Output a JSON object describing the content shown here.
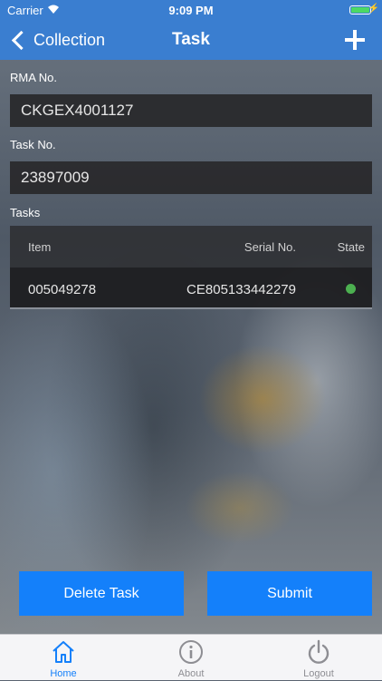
{
  "status_bar": {
    "carrier": "Carrier",
    "time": "9:09 PM"
  },
  "nav": {
    "back_label": "Collection",
    "title": "Task",
    "add_icon": "plus-icon"
  },
  "form": {
    "rma_label": "RMA No.",
    "rma_value": "CKGEX4001127",
    "task_label": "Task No.",
    "task_value": "23897009",
    "tasks_label": "Tasks"
  },
  "table": {
    "headers": {
      "item": "Item",
      "serial": "Serial No.",
      "state": "State"
    },
    "rows": [
      {
        "item": "005049278",
        "serial": "CE805133442279",
        "state_color": "#4cb050"
      }
    ]
  },
  "buttons": {
    "delete": "Delete Task",
    "submit": "Submit"
  },
  "tabs": [
    {
      "label": "Home",
      "icon": "home-icon",
      "active": true
    },
    {
      "label": "About",
      "icon": "info-icon",
      "active": false
    },
    {
      "label": "Logout",
      "icon": "power-icon",
      "active": false
    }
  ],
  "colors": {
    "accent": "#1480fa",
    "navbar": "#3a7ed0"
  }
}
